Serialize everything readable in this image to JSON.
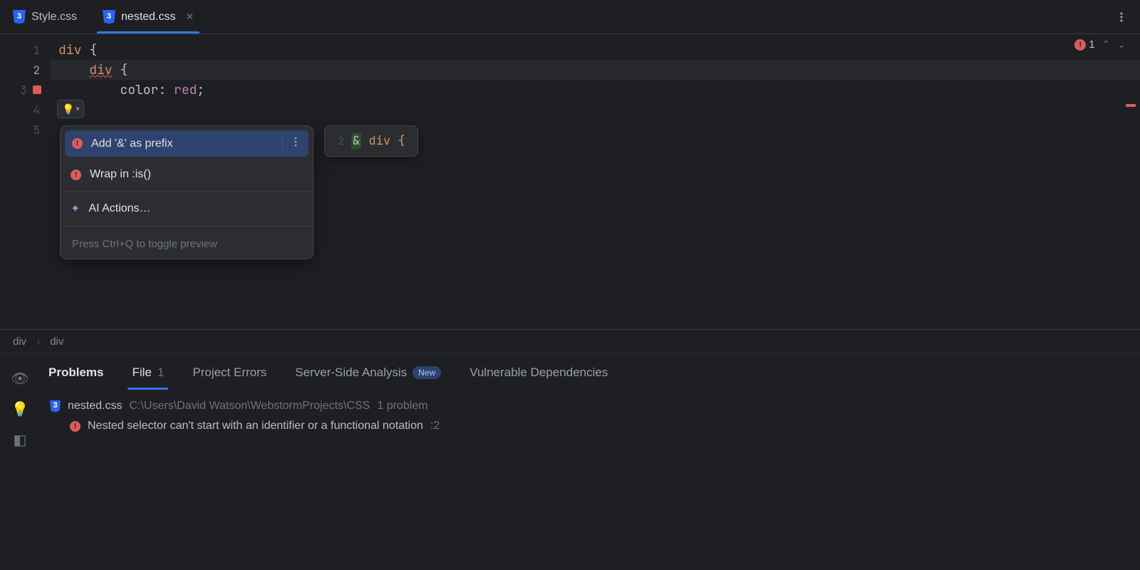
{
  "tabs": [
    {
      "label": "Style.css",
      "active": false
    },
    {
      "label": "nested.css",
      "active": true
    }
  ],
  "error_widget": {
    "count": "1"
  },
  "code": {
    "l1_tag": "div",
    "l1_brace": " {",
    "l2_indent": "    ",
    "l2_tag": "div",
    "l2_brace": " {",
    "l3_indent": "        ",
    "l3_prop": "color",
    "l3_colon": ": ",
    "l3_val": "red",
    "l3_end": ";"
  },
  "popup": {
    "items": [
      {
        "label": "Add '&' as prefix",
        "icon": "error-bulb"
      },
      {
        "label": "Wrap in :is()",
        "icon": "error-bulb"
      },
      {
        "label": "AI Actions…",
        "icon": "ai"
      }
    ],
    "hint": "Press Ctrl+Q to toggle preview"
  },
  "preview": {
    "line_no": "2",
    "amp": "&",
    "rest": " div {"
  },
  "breadcrumb": [
    "div",
    "div"
  ],
  "panel": {
    "title": "Problems",
    "tabs": [
      {
        "label": "File",
        "count": "1"
      },
      {
        "label": "Project Errors"
      },
      {
        "label": "Server-Side Analysis",
        "badge": "New"
      },
      {
        "label": "Vulnerable Dependencies"
      }
    ],
    "file": {
      "name": "nested.css",
      "path": "C:\\Users\\David Watson\\WebstormProjects\\CSS",
      "problem_count": "1 problem"
    },
    "issue": {
      "text": "Nested selector can't start with an identifier or a functional notation",
      "loc": ":2"
    }
  }
}
